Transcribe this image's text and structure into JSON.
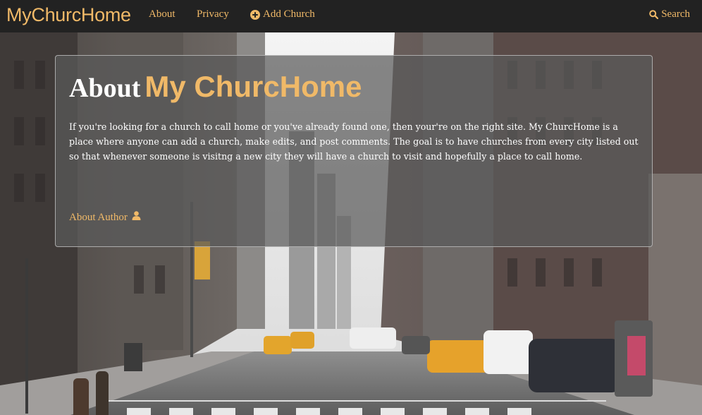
{
  "navbar": {
    "brand": "MyChurcHome",
    "links": [
      {
        "label": "About"
      },
      {
        "label": "Privacy"
      },
      {
        "label": "Add Church",
        "icon": "plus-circle-icon"
      }
    ],
    "search": {
      "label": "Search",
      "icon": "search-icon"
    }
  },
  "about": {
    "title_prefix": "About",
    "title_brand": "My ChurcHome",
    "body": "If you're looking for a church to call home or you've already found one, then your're on the right site. My ChurcHome is a place where anyone can add a church, make edits, and post comments. The goal is to have churches from every city listed out so that whenever someone is visitng a new city they will have a church to visit and hopefully a place to call home.",
    "author_link": "About Author",
    "author_icon": "user-icon"
  },
  "colors": {
    "accent": "#f0b968",
    "navbar_bg": "#222222",
    "panel_bg": "rgba(90,90,90,0.72)"
  }
}
